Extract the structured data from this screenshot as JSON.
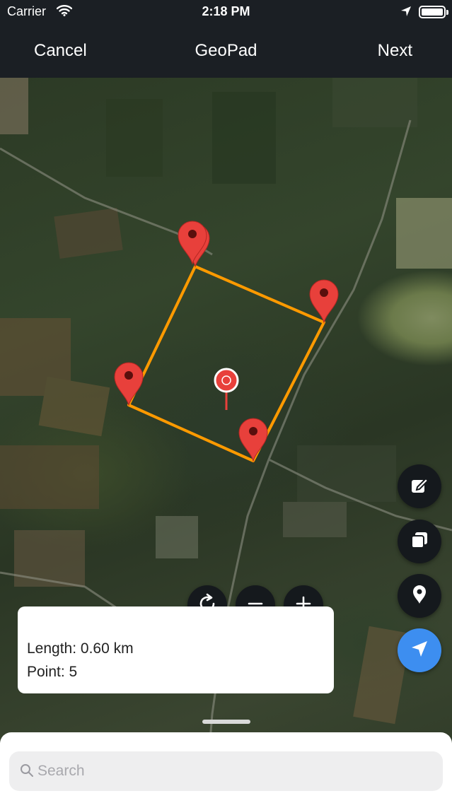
{
  "status_bar": {
    "carrier": "Carrier",
    "time": "2:18 PM"
  },
  "nav": {
    "cancel_label": "Cancel",
    "title": "GeoPad",
    "next_label": "Next"
  },
  "info": {
    "length_text": "Length: 0.60 km",
    "points_text": "Point: 5"
  },
  "search": {
    "placeholder": "Search"
  },
  "map": {
    "view": "satellite",
    "polygon_color": "#ff9a00",
    "marker_color": "#e8403b",
    "point_count": 5
  },
  "controls": {
    "icons": [
      "refresh-icon",
      "zoom-out-icon",
      "zoom-in-icon"
    ]
  },
  "side_buttons": {
    "icons": [
      "edit-icon",
      "layers-icon",
      "pin-icon",
      "navigation-arrow-icon"
    ],
    "accent": "#3d8ef0"
  }
}
